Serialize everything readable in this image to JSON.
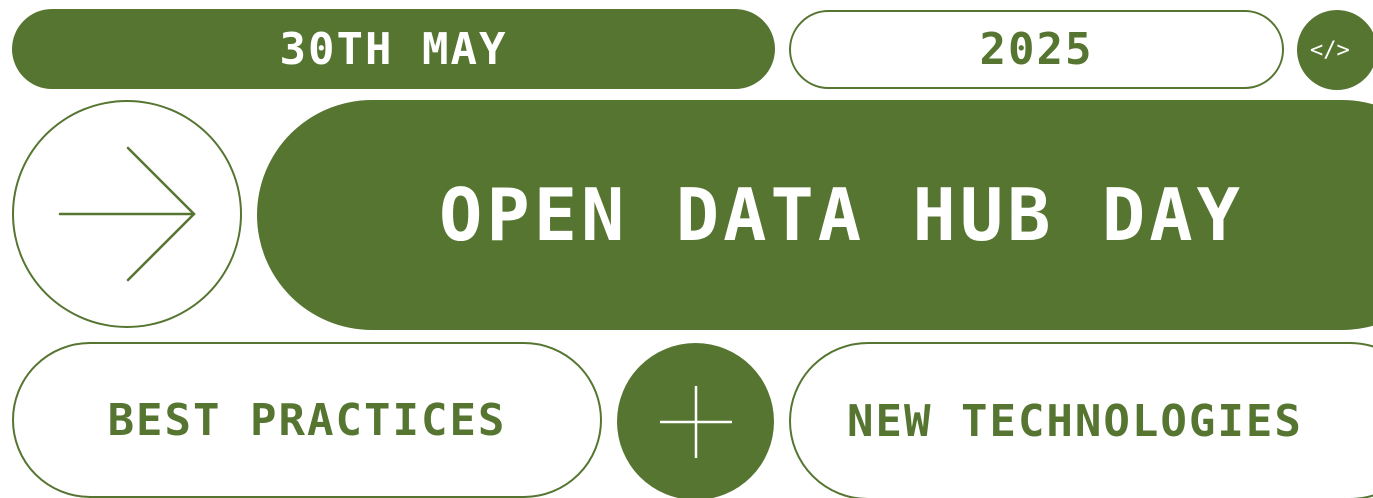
{
  "event": {
    "date": "30TH MAY",
    "year": "2025",
    "code_glyph": "</>",
    "title": "OPEN DATA HUB DAY",
    "topic_left": "BEST PRACTICES",
    "topic_right": "NEW TECHNOLOGIES"
  },
  "icons": {
    "code": "code-brackets-icon",
    "arrow": "arrow-right-icon",
    "plus": "plus-icon"
  },
  "colors": {
    "accent": "#557531",
    "background": "#ffffff",
    "text_on_accent": "#ffffff"
  }
}
